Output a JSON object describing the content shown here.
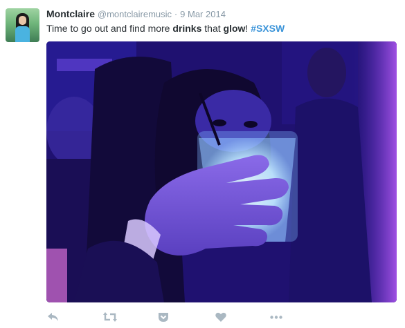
{
  "tweet": {
    "name": "Montclaire",
    "handle": "@montclairemusic",
    "separator": "·",
    "date": "9 Mar 2014",
    "text": {
      "part1": "Time to go out and find more ",
      "bold1": "drinks",
      "part2": " that ",
      "bold2": "glow",
      "part3": "! ",
      "hashtag": "#SXSW"
    }
  },
  "actions": [
    {
      "icon": "reply-icon"
    },
    {
      "icon": "retweet-icon"
    },
    {
      "icon": "pocket-icon"
    },
    {
      "icon": "heart-icon"
    },
    {
      "icon": "more-icon"
    }
  ],
  "colors": {
    "name": "#292f33",
    "meta": "#8899a6",
    "hashtag": "#3b94d9",
    "action_icon": "#aab8c2"
  }
}
